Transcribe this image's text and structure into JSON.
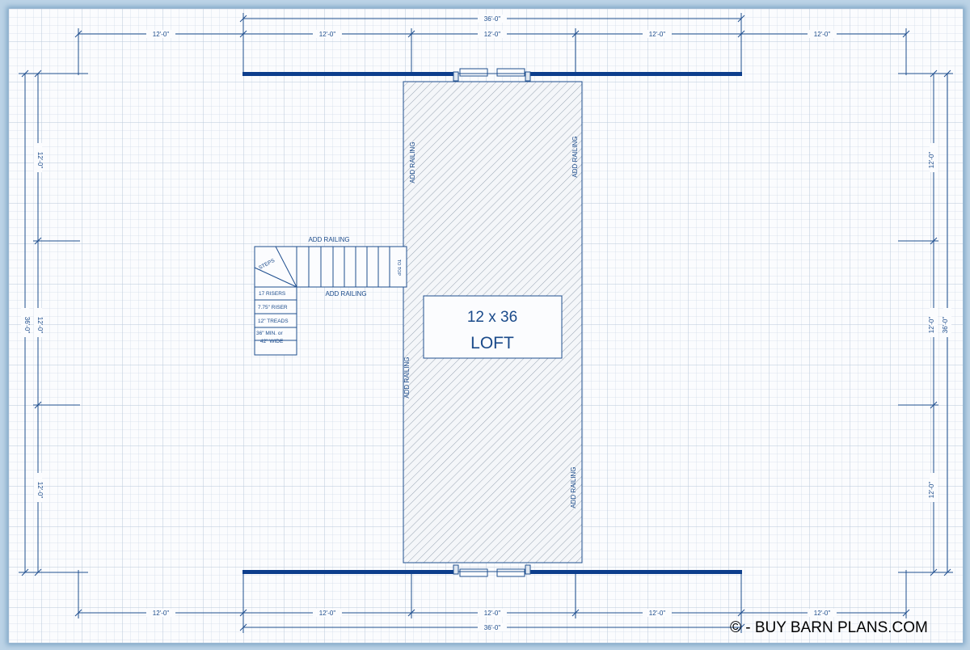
{
  "dimensions": {
    "overall_width": "36'-0\"",
    "bay": "12'-0\"",
    "overall_depth": "36'-0\""
  },
  "loft": {
    "line1": "12 x 36",
    "line2": "LOFT"
  },
  "railing": {
    "stair_top": "ADD RAILING",
    "stair_bottom": "ADD RAILING",
    "left_upper": "ADD RAILING",
    "left_lower": "ADD RAILING",
    "right_upper": "ADD RAILING",
    "right_lower": "ADD RAILING"
  },
  "stairs": {
    "steps": "STEPS",
    "top_label": "TO TOP",
    "risers": "17 RISERS",
    "riser_height": "7.75\" RISER",
    "treads": "12\" TREADS",
    "width_line1": "36\" MIN. or",
    "width_line2": "42\" WIDE"
  },
  "copyright": "© - BUY BARN PLANS.COM",
  "colors": {
    "line": "#1f4f8f",
    "wall": "#0d3e8c",
    "grid": "#cfdbe8",
    "text": "#1a4a8a"
  }
}
